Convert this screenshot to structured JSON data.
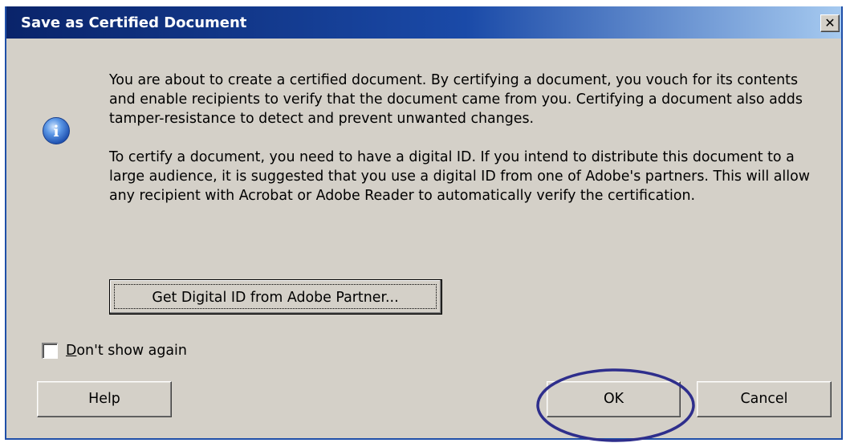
{
  "dialog": {
    "title": "Save as Certified Document",
    "close_glyph": "✕",
    "icon": "info-icon",
    "icon_glyph": "i",
    "paragraphs": [
      "You are about to create a certified document. By certifying a document, you vouch for its contents and enable recipients to verify that the document came from you. Certifying a document also adds tamper-resistance to detect and prevent unwanted changes.",
      "To certify a document, you need to have a digital ID. If you intend to distribute this document to a large audience, it is suggested that you use a digital ID from one of Adobe's partners. This will allow any recipient with Acrobat or Adobe Reader to automatically verify the certification."
    ],
    "partner_button_label": "Get Digital ID from Adobe Partner...",
    "dont_show_again": {
      "mnemonic": "D",
      "label_rest": "on't show again",
      "checked": false
    },
    "buttons": {
      "help": "Help",
      "ok": "OK",
      "cancel": "Cancel"
    }
  },
  "colors": {
    "title_bar_start": "#0a246a",
    "title_bar_end": "#a6caf0",
    "dialog_face": "#d4d0c8",
    "info_icon": "#2f6fd6",
    "highlight_ring": "#2e2e8c"
  }
}
